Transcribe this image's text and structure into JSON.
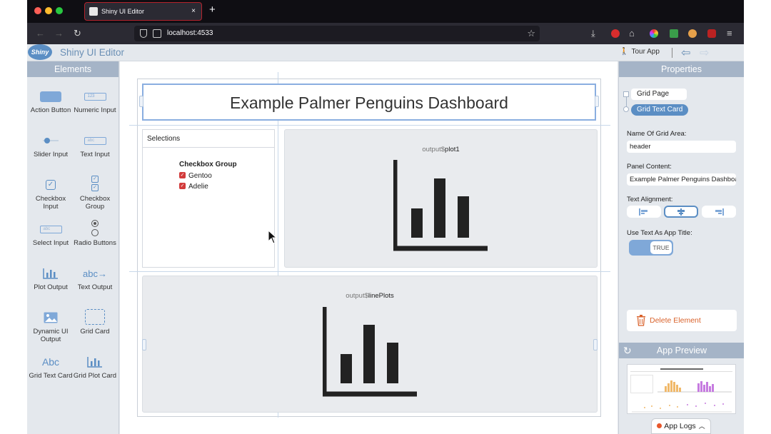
{
  "browser": {
    "tab_title": "Shiny UI Editor",
    "tab_close": "×",
    "new_tab": "+",
    "url": "localhost:4533"
  },
  "app": {
    "logo_text": "Shiny",
    "title": "Shiny UI Editor",
    "tour_label": "Tour App"
  },
  "elements_panel": {
    "title": "Elements",
    "items": [
      {
        "label": "Action Button",
        "icon": "action-button-icon"
      },
      {
        "label": "Numeric Input",
        "icon": "numeric-input-icon"
      },
      {
        "label": "Slider Input",
        "icon": "slider-icon"
      },
      {
        "label": "Text Input",
        "icon": "text-input-icon"
      },
      {
        "label": "Checkbox Input",
        "icon": "checkbox-icon"
      },
      {
        "label": "Checkbox Group",
        "icon": "checkbox-group-icon"
      },
      {
        "label": "Select Input",
        "icon": "select-input-icon"
      },
      {
        "label": "Radio Buttons",
        "icon": "radio-buttons-icon"
      },
      {
        "label": "Plot Output",
        "icon": "plot-output-icon"
      },
      {
        "label": "Text Output",
        "icon": "text-output-icon"
      },
      {
        "label": "Dynamic UI Output",
        "icon": "dynamic-ui-icon"
      },
      {
        "label": "Grid Card",
        "icon": "grid-card-icon"
      },
      {
        "label": "Grid Text Card",
        "icon": "grid-text-card-icon"
      },
      {
        "label": "Grid Plot Card",
        "icon": "grid-plot-card-icon"
      }
    ],
    "numeric_icon_text": "123",
    "text_input_icon_text": "abc",
    "select_icon_text": "abc",
    "text_output_icon_text": "abc",
    "grid_text_icon_text": "Abc"
  },
  "canvas": {
    "header_title": "Example Palmer Penguins Dashboard",
    "selections_card": {
      "title": "Selections",
      "group_label": "Checkbox Group",
      "options": [
        "Gentoo",
        "Adelie"
      ]
    },
    "plot1": {
      "prefix": "output$",
      "name": "plot1"
    },
    "plot2": {
      "prefix": "output$",
      "name": "linePlots"
    }
  },
  "properties": {
    "title": "Properties",
    "tree": [
      "Grid Page",
      "Grid Text Card"
    ],
    "area_label": "Name Of Grid Area:",
    "area_value": "header",
    "content_label": "Panel Content:",
    "content_value": "Example Palmer Penguins Dashboard",
    "alignment_label": "Text Alignment:",
    "title_toggle_label": "Use Text As App Title:",
    "toggle_value": "TRUE",
    "delete_label": "Delete Element",
    "preview_title": "App Preview",
    "logs_label": "App Logs"
  },
  "colors": {
    "accent": "#5b8ec4",
    "panel_header": "#a5b4c7",
    "delete": "#d9622b",
    "checkbox": "#d23b3b"
  }
}
